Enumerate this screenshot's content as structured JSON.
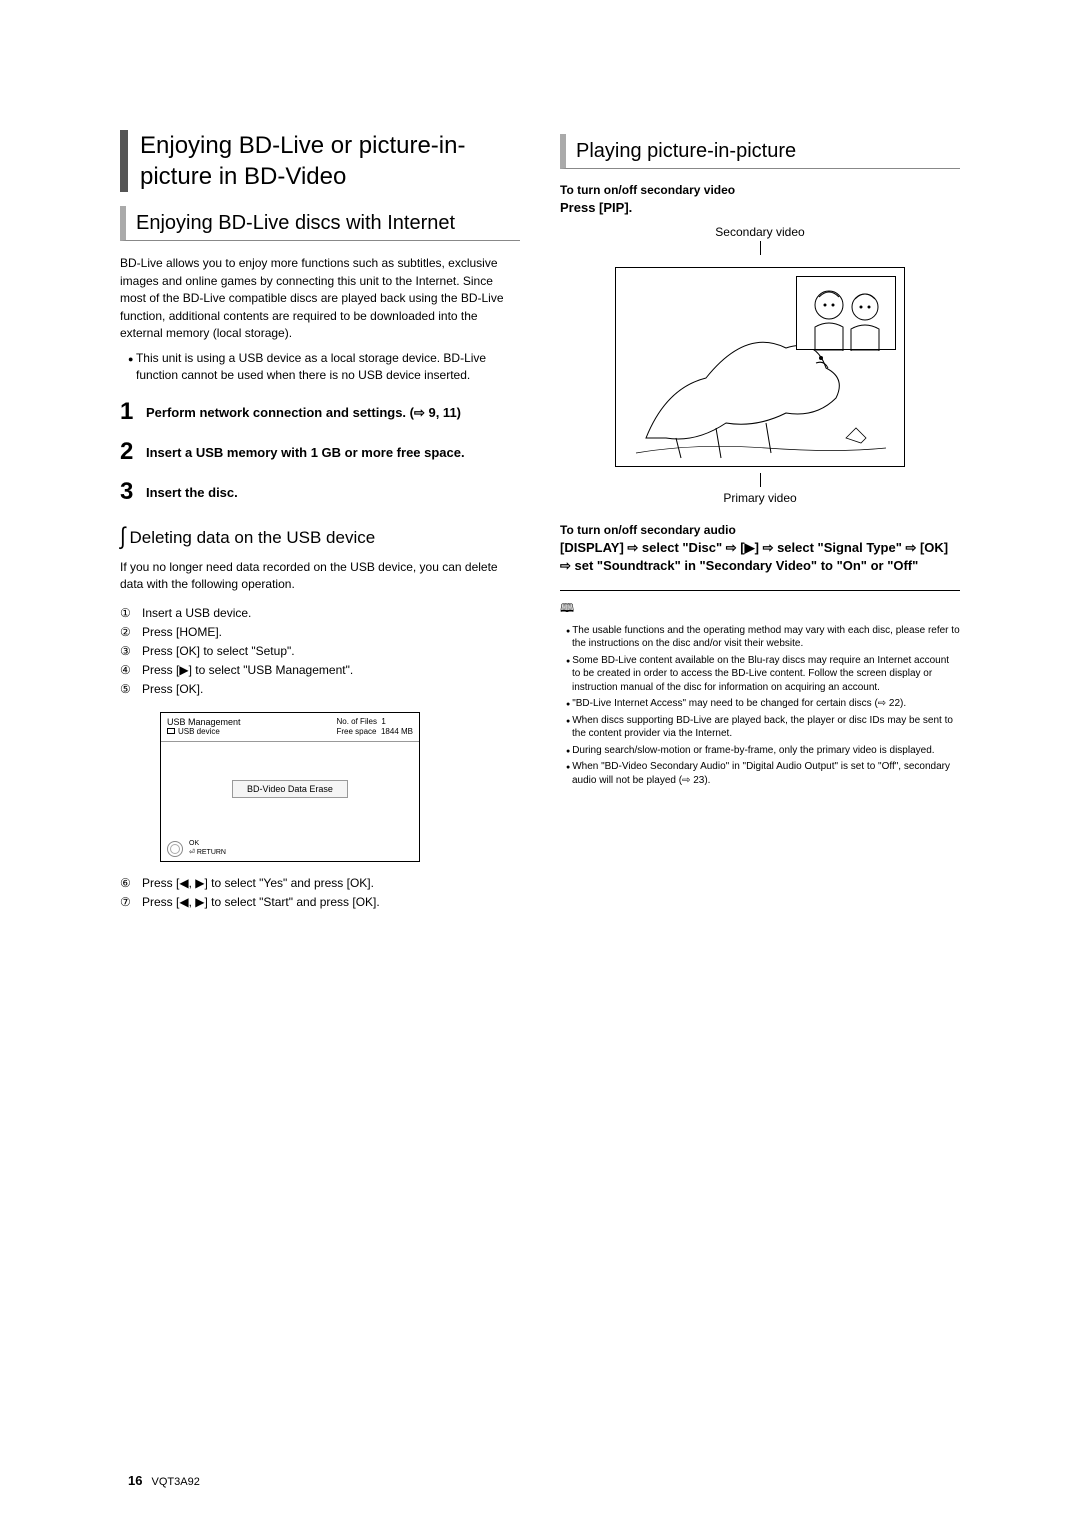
{
  "left": {
    "main_title": "Enjoying BD-Live or picture-in-picture in BD-Video",
    "sub_title_bold": "Enjoying BD-Live",
    "sub_title_light": " discs with Internet",
    "intro": "BD-Live allows you to enjoy more functions such as subtitles, exclusive images and online games by connecting this unit to the Internet. Since most of the BD-Live compatible discs are played back using the BD-Live function, additional contents are required to be downloaded into the external memory (local storage).",
    "bullet1": "This unit is using a USB device as a local storage device. BD-Live function cannot be used when there is no USB device inserted.",
    "step1": "Perform network connection and settings. (⇨ 9, 11)",
    "step2": "Insert a USB memory with 1 GB or more free space.",
    "step3": "Insert the disc.",
    "delete_h": "Deleting data on the USB device",
    "delete_intro": "If you no longer need data recorded on the USB device, you can delete data with the following operation.",
    "c1": "Insert a USB device.",
    "c2": "Press [HOME].",
    "c3": "Press [OK] to select \"Setup\".",
    "c4": "Press [▶] to select \"USB Management\".",
    "c5": "Press [OK].",
    "c6": "Press [◀, ▶] to select \"Yes\" and press [OK].",
    "c7": "Press [◀, ▶] to select \"Start\" and press [OK].",
    "sb": {
      "title": "USB Management",
      "device": "USB device",
      "nfiles_lbl": "No. of Files",
      "nfiles_val": "1",
      "free_lbl": "Free space",
      "free_val": "1844 MB",
      "erase": "BD-Video Data Erase",
      "ok": "OK",
      "return": "RETURN"
    }
  },
  "right": {
    "title": "Playing picture-in-picture",
    "tv_on": "To turn on/off secondary video",
    "press_pip": "Press [PIP].",
    "secvid": "Secondary video",
    "primvid": "Primary video",
    "ta_on": "To turn on/off secondary audio",
    "display_line": "[DISPLAY] ⇨ select \"Disc\" ⇨ [▶] ⇨ select \"Signal Type\" ⇨ [OK] ⇨ set \"Soundtrack\" in \"Secondary Video\" to \"On\" or \"Off\"",
    "notes": [
      "The usable functions and the operating method may vary with each disc, please refer to the instructions on the disc and/or visit their website.",
      "Some BD-Live content available on the Blu-ray discs may require an Internet account to be created in order to access the BD-Live content. Follow the screen display or instruction manual of the disc for information on acquiring an account.",
      "\"BD-Live Internet Access\" may need to be changed for certain discs (⇨ 22).",
      "When discs supporting BD-Live are played back, the player or disc IDs may be sent to the content provider via the Internet.",
      "During search/slow-motion or frame-by-frame, only the primary video is displayed.",
      "When \"BD-Video Secondary Audio\" in \"Digital Audio Output\" is set to \"Off\", secondary audio will not be played (⇨ 23)."
    ]
  },
  "footer": {
    "page": "16",
    "code": "VQT3A92"
  }
}
